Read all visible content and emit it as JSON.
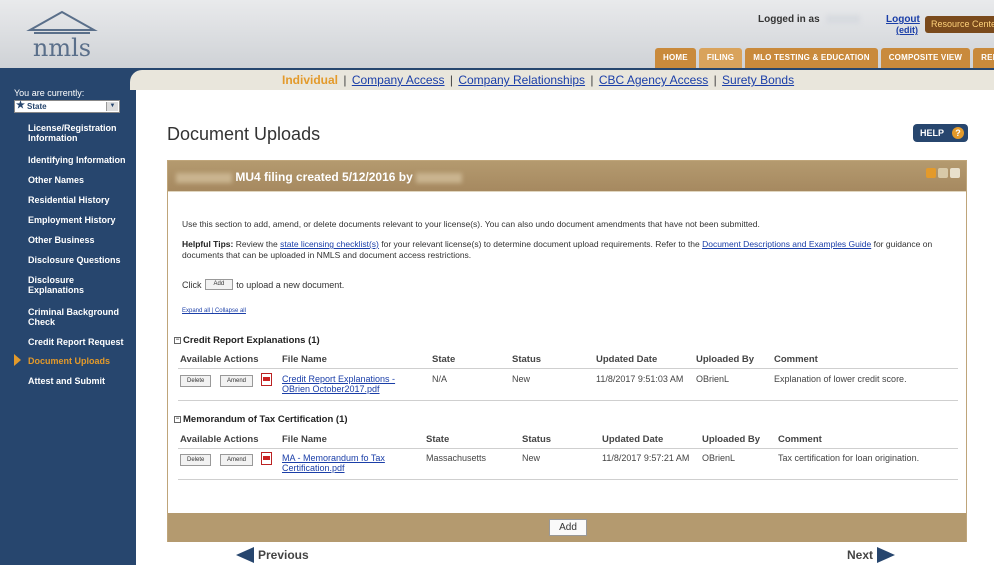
{
  "header": {
    "logo_text": "nmls",
    "logged_in_label": "Logged in as",
    "logout_label": "Logout",
    "edit_label": "(edit)",
    "resource_center_label": "Resource Center",
    "tabs": [
      {
        "label": "HOME",
        "active": false
      },
      {
        "label": "FILING",
        "active": true
      },
      {
        "label": "MLO TESTING & EDUCATION",
        "active": false
      },
      {
        "label": "COMPOSITE VIEW",
        "active": false
      },
      {
        "label": "RENEWALS",
        "active": false
      }
    ]
  },
  "subnav": {
    "items": [
      "Individual",
      "Company Access",
      "Company Relationships",
      "CBC Agency Access",
      "Surety Bonds"
    ],
    "selected": "Individual"
  },
  "sidebar": {
    "you_are_currently": "You are currently:",
    "state_select_value": "State",
    "items": [
      {
        "label": "License/Registration Information",
        "active": false
      },
      {
        "label": "Identifying Information",
        "active": false
      },
      {
        "label": "Other Names",
        "active": false
      },
      {
        "label": "Residential History",
        "active": false
      },
      {
        "label": "Employment History",
        "active": false
      },
      {
        "label": "Other Business",
        "active": false
      },
      {
        "label": "Disclosure Questions",
        "active": false
      },
      {
        "label": "Disclosure Explanations",
        "active": false
      },
      {
        "label": "Criminal Background Check",
        "active": false
      },
      {
        "label": "Credit Report Request",
        "active": false
      },
      {
        "label": "Document Uploads",
        "active": true
      },
      {
        "label": "Attest and Submit",
        "active": false
      }
    ]
  },
  "main": {
    "page_title": "Document Uploads",
    "help_label": "HELP",
    "panel_title": "MU4 filing created 5/12/2016 by",
    "intro_text": "Use this section to add, amend, or delete documents relevant to your license(s). You can also undo document amendments that have not been submitted.",
    "tips": {
      "label": "Helpful Tips:",
      "part1": "Review the",
      "link1": "state licensing checklist(s)",
      "part2": "for your relevant license(s) to determine document upload requirements. Refer to the",
      "link2": "Document Descriptions and Examples Guide",
      "part3": "for guidance on documents that can be uploaded in NMLS and document access restrictions."
    },
    "click_label": "Click",
    "add_mini_label": "Add",
    "click_suffix": "to upload a new document.",
    "expand_all": "Expand all",
    "collapse_all": "Collapse all",
    "columns": [
      "Available Actions",
      "File Name",
      "State",
      "Status",
      "Updated Date",
      "Uploaded By",
      "Comment"
    ],
    "sections": [
      {
        "title": "Credit Report Explanations",
        "count": "(1)",
        "rows": [
          {
            "delete_label": "Delete",
            "amend_label": "Amend",
            "file_name": "Credit Report Explanations - OBrien October2017.pdf",
            "state": "N/A",
            "status": "New",
            "updated_date": "11/8/2017 9:51:03 AM",
            "uploaded_by": "OBrienL",
            "comment": "Explanation of lower credit score."
          }
        ]
      },
      {
        "title": "Memorandum of Tax Certification",
        "count": "(1)",
        "rows": [
          {
            "delete_label": "Delete",
            "amend_label": "Amend",
            "file_name": "MA - Memorandum fo Tax Certification.pdf",
            "state": "Massachusetts",
            "status": "New",
            "updated_date": "11/8/2017 9:57:21 AM",
            "uploaded_by": "OBrienL",
            "comment": "Tax certification for loan origination."
          }
        ]
      }
    ],
    "add_button_label": "Add"
  },
  "footer_nav": {
    "previous_label": "Previous",
    "next_label": "Next"
  },
  "colors": {
    "navy": "#27466e",
    "accent_orange": "#e39a2b",
    "panel_tan": "#b49a6f",
    "link_blue": "#1a3ea8"
  }
}
